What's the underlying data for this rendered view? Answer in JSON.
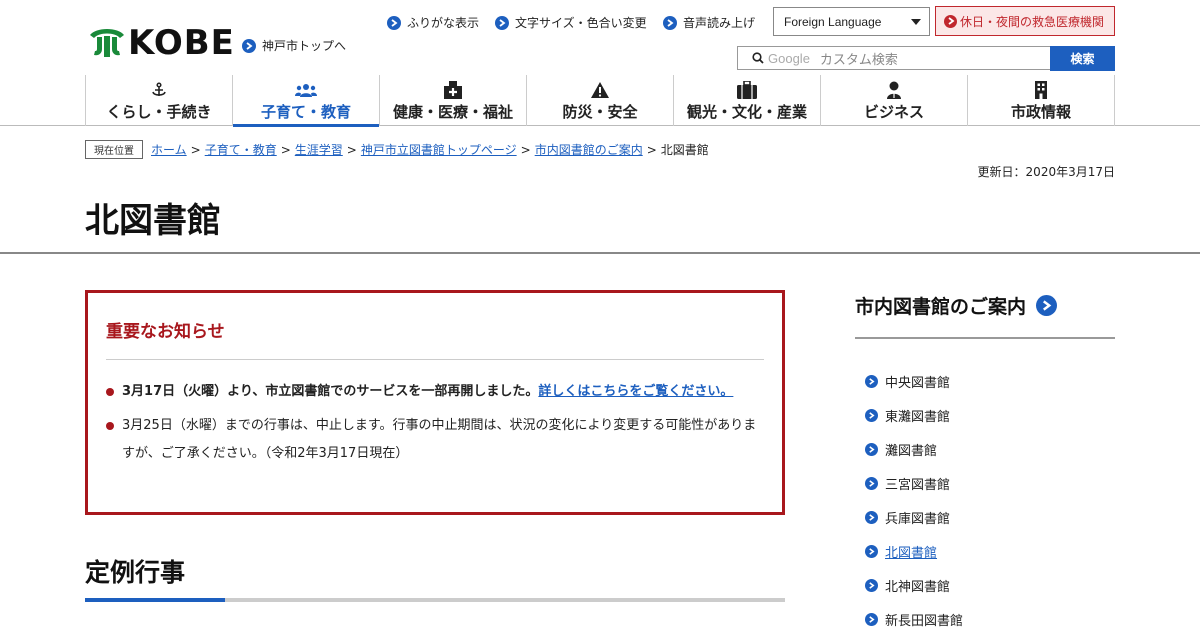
{
  "header": {
    "logo_text": "KOBE",
    "kobe_top_link": "神戸市トップへ",
    "util_links": [
      "ふりがな表示",
      "文字サイズ・色合い変更",
      "音声読み上げ"
    ],
    "language_select": "Foreign Language",
    "emergency_link": "休日・夜間の救急医療機関",
    "search_brand": "Google",
    "search_placeholder": "カスタム検索",
    "search_button": "検索"
  },
  "nav": {
    "items": [
      {
        "label": "くらし・手続き",
        "icon": "anchor-icon"
      },
      {
        "label": "子育て・教育",
        "icon": "people-icon"
      },
      {
        "label": "健康・医療・福祉",
        "icon": "hospital-icon"
      },
      {
        "label": "防災・安全",
        "icon": "warning-icon"
      },
      {
        "label": "観光・文化・産業",
        "icon": "suitcase-icon"
      },
      {
        "label": "ビジネス",
        "icon": "person-icon"
      },
      {
        "label": "市政情報",
        "icon": "building-icon"
      }
    ],
    "active_index": 1
  },
  "breadcrumb": {
    "badge": "現在位置",
    "links": [
      "ホーム",
      "子育て・教育",
      "生涯学習",
      "神戸市立図書館トップページ",
      "市内図書館のご案内"
    ],
    "current": "北図書館",
    "separator": ">"
  },
  "updated": "更新日：2020年3月17日",
  "page_title": "北図書館",
  "notice": {
    "title": "重要なお知らせ",
    "item1_text": "3月17日（火曜）より、市立図書館でのサービスを一部再開しました。",
    "item1_link": "詳しくはこちらをご覧ください。",
    "item2_text": "3月25日（水曜）までの行事は、中止します。行事の中止期間は、状況の変化により変更する可能性がありますが、ご了承ください。（令和2年3月17日現在）"
  },
  "section_title": "定例行事",
  "side": {
    "title": "市内図書館のご案内",
    "items": [
      "中央図書館",
      "東灘図書館",
      "灘図書館",
      "三宮図書館",
      "兵庫図書館",
      "北図書館",
      "北神図書館",
      "新長田図書館"
    ],
    "current_index": 5
  },
  "colors": {
    "accent_blue": "#1d5fbf",
    "alert_red": "#a8171d",
    "logo_green": "#1a8a3a"
  }
}
